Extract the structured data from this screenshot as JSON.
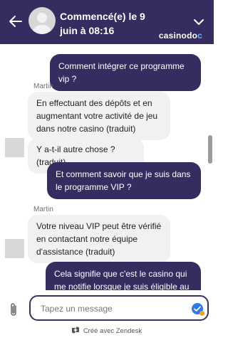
{
  "header": {
    "title": "Commencé(e) le 9 juin à 08:16",
    "brand_name": "casinodoc",
    "brand_prefix": "casino",
    "brand_mid": "do",
    "brand_dot": "c",
    "bg_color": "#372c5f"
  },
  "messages": [
    {
      "direction": "outgoing",
      "text": "Comment intégrer ce programme vip ?"
    },
    {
      "direction": "incoming",
      "sender": "Martin",
      "text": "En effectuant des dépôts et en augmentant votre activité de jeu dans notre casino (traduit)"
    },
    {
      "direction": "incoming",
      "text": "Y a-t-il autre chose ? (traduit)"
    },
    {
      "direction": "outgoing",
      "text": "Et comment savoir que je suis dans le programme VIP ?"
    },
    {
      "direction": "incoming",
      "sender": "Martin",
      "text": "Votre niveau VIP peut être vérifié en contactant notre équipe d'assistance (traduit)"
    },
    {
      "direction": "outgoing",
      "text": "Cela signifie que c'est le casino qui me notifie lorsque je suis éligible au"
    }
  ],
  "composer": {
    "placeholder": "Tapez un message"
  },
  "footer": {
    "credit": "Créé avec Zendesk"
  },
  "colors": {
    "accent": "#372c5f",
    "incoming_bubble": "#f1f1f4",
    "send_icon": "#2f7be3"
  },
  "icons": [
    "back-arrow-icon",
    "chevron-down-icon",
    "paperclip-icon",
    "send-icon",
    "zendesk-logo-icon"
  ]
}
